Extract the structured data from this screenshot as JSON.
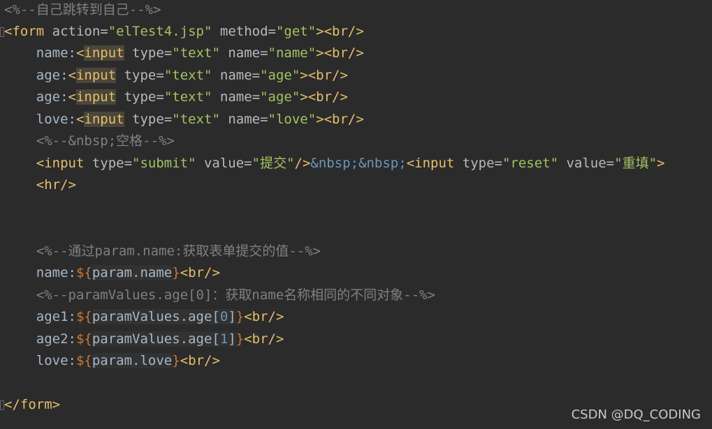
{
  "editor": {
    "background": "#2b2b2b",
    "lines": [
      {
        "segments": [
          {
            "t": "<%--自己跳转到自己--%>",
            "c": "comment"
          }
        ]
      },
      {
        "fold": true,
        "segments": [
          {
            "t": "<form",
            "c": "tag"
          },
          {
            "t": " action=",
            "c": "attr"
          },
          {
            "t": "\"elTest4.jsp\"",
            "c": "string"
          },
          {
            "t": " method=",
            "c": "attr"
          },
          {
            "t": "\"get\"",
            "c": "string"
          },
          {
            "t": "><br/>",
            "c": "tag"
          }
        ]
      },
      {
        "segments": [
          {
            "t": "    name:",
            "c": "text"
          },
          {
            "t": "<",
            "c": "tag"
          },
          {
            "t": "input",
            "c": "tag",
            "hl": true
          },
          {
            "t": " type=",
            "c": "attr"
          },
          {
            "t": "\"text\"",
            "c": "string"
          },
          {
            "t": " name=",
            "c": "attr"
          },
          {
            "t": "\"name\"",
            "c": "string"
          },
          {
            "t": "><br/>",
            "c": "tag"
          }
        ]
      },
      {
        "segments": [
          {
            "t": "    age:",
            "c": "text"
          },
          {
            "t": "<",
            "c": "tag"
          },
          {
            "t": "input",
            "c": "tag",
            "hl": true
          },
          {
            "t": " type=",
            "c": "attr"
          },
          {
            "t": "\"text\"",
            "c": "string"
          },
          {
            "t": " name=",
            "c": "attr"
          },
          {
            "t": "\"age\"",
            "c": "string"
          },
          {
            "t": "><br/>",
            "c": "tag"
          }
        ]
      },
      {
        "segments": [
          {
            "t": "    age:",
            "c": "text"
          },
          {
            "t": "<",
            "c": "tag"
          },
          {
            "t": "input",
            "c": "tag",
            "hl": true
          },
          {
            "t": " type=",
            "c": "attr"
          },
          {
            "t": "\"text\"",
            "c": "string"
          },
          {
            "t": " name=",
            "c": "attr"
          },
          {
            "t": "\"age\"",
            "c": "string"
          },
          {
            "t": "><br/>",
            "c": "tag"
          }
        ]
      },
      {
        "segments": [
          {
            "t": "    love:",
            "c": "text"
          },
          {
            "t": "<",
            "c": "tag"
          },
          {
            "t": "input",
            "c": "tag",
            "hl": true
          },
          {
            "t": " type=",
            "c": "attr"
          },
          {
            "t": "\"text\"",
            "c": "string"
          },
          {
            "t": " name=",
            "c": "attr"
          },
          {
            "t": "\"love\"",
            "c": "string"
          },
          {
            "t": "><br/>",
            "c": "tag"
          }
        ]
      },
      {
        "segments": [
          {
            "t": "    <%--&nbsp;空格--%>",
            "c": "comment"
          }
        ]
      },
      {
        "segments": [
          {
            "t": "    <input",
            "c": "tag"
          },
          {
            "t": " type=",
            "c": "attr"
          },
          {
            "t": "\"submit\"",
            "c": "string"
          },
          {
            "t": " value=",
            "c": "attr"
          },
          {
            "t": "\"提交\"",
            "c": "string"
          },
          {
            "t": "/>",
            "c": "tag"
          },
          {
            "t": "&nbsp;&nbsp;",
            "c": "entity"
          },
          {
            "t": "<input",
            "c": "tag"
          },
          {
            "t": " type=",
            "c": "attr"
          },
          {
            "t": "\"reset\"",
            "c": "string"
          },
          {
            "t": " value=",
            "c": "attr"
          },
          {
            "t": "\"重填\"",
            "c": "string"
          },
          {
            "t": ">",
            "c": "tag"
          }
        ]
      },
      {
        "segments": [
          {
            "t": "    <hr/>",
            "c": "tag"
          }
        ]
      },
      {
        "segments": []
      },
      {
        "segments": []
      },
      {
        "segments": [
          {
            "t": "    <%--通过param.name:获取表单提交的值--%>",
            "c": "comment"
          }
        ]
      },
      {
        "segments": [
          {
            "t": "    name:",
            "c": "text"
          },
          {
            "t": "${",
            "c": "elbrace"
          },
          {
            "t": "param.name",
            "c": "elexpr"
          },
          {
            "t": "}",
            "c": "elbrace"
          },
          {
            "t": "<br/>",
            "c": "tag"
          }
        ]
      },
      {
        "segments": [
          {
            "t": "    <%--paramValues.age[0]：获取name名称相同的不同对象--%>",
            "c": "comment"
          }
        ]
      },
      {
        "segments": [
          {
            "t": "    age1:",
            "c": "text"
          },
          {
            "t": "${",
            "c": "elbrace"
          },
          {
            "t": "paramValues.age[",
            "c": "elexpr"
          },
          {
            "t": "0",
            "c": "number"
          },
          {
            "t": "]",
            "c": "elexpr"
          },
          {
            "t": "}",
            "c": "elbrace"
          },
          {
            "t": "<br/>",
            "c": "tag"
          }
        ]
      },
      {
        "segments": [
          {
            "t": "    age2:",
            "c": "text"
          },
          {
            "t": "${",
            "c": "elbrace"
          },
          {
            "t": "paramValues.age[",
            "c": "elexpr"
          },
          {
            "t": "1",
            "c": "number"
          },
          {
            "t": "]",
            "c": "elexpr"
          },
          {
            "t": "}",
            "c": "elbrace"
          },
          {
            "t": "<br/>",
            "c": "tag"
          }
        ]
      },
      {
        "segments": [
          {
            "t": "    love:",
            "c": "text"
          },
          {
            "t": "${",
            "c": "elbrace"
          },
          {
            "t": "param.love",
            "c": "elexpr"
          },
          {
            "t": "}",
            "c": "elbrace"
          },
          {
            "t": "<br/>",
            "c": "tag"
          }
        ]
      },
      {
        "segments": []
      },
      {
        "fold": true,
        "segments": [
          {
            "t": "</form>",
            "c": "tag"
          }
        ]
      }
    ]
  },
  "watermark": "CSDN @DQ_CODING"
}
